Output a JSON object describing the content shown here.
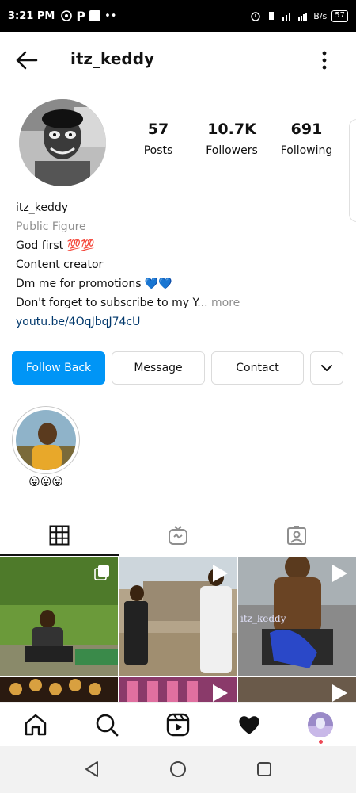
{
  "status_bar": {
    "time": "3:21 PM",
    "battery": "57",
    "net_rate": "B/s",
    "icons": [
      "whatsapp-icon",
      "p-icon",
      "square-icon",
      "dots-icon",
      "alarm-icon",
      "vibrate-icon",
      "signal-icon",
      "wifi-icon",
      "battery-icon"
    ]
  },
  "header": {
    "username": "itz_keddy"
  },
  "stats": {
    "posts_value": "57",
    "posts_label": "Posts",
    "followers_value": "10.7K",
    "followers_label": "Followers",
    "following_value": "691",
    "following_label": "Following"
  },
  "bio": {
    "name": "itz_keddy",
    "category": "Public Figure",
    "line1": "God first 💯💯",
    "line2": "Content creator",
    "line3": "Dm me for promotions 💙💙",
    "line4": "Don't forget to subscribe to my Y",
    "line4_more": "... more",
    "link": "youtu.be/4OqJbqJ74cU"
  },
  "actions": {
    "follow_back": "Follow Back",
    "message": "Message",
    "contact": "Contact"
  },
  "highlights": [
    {
      "label": "😛😛😛"
    }
  ],
  "tabs": [
    "grid-tab",
    "reels-tab",
    "tagged-tab"
  ],
  "colors": {
    "accent": "#0095f6",
    "link": "#00376b",
    "muted": "#8e8e8e",
    "notification_dot": "#ed4956"
  },
  "grid": {
    "cell2_caption": "itz_keddy"
  }
}
